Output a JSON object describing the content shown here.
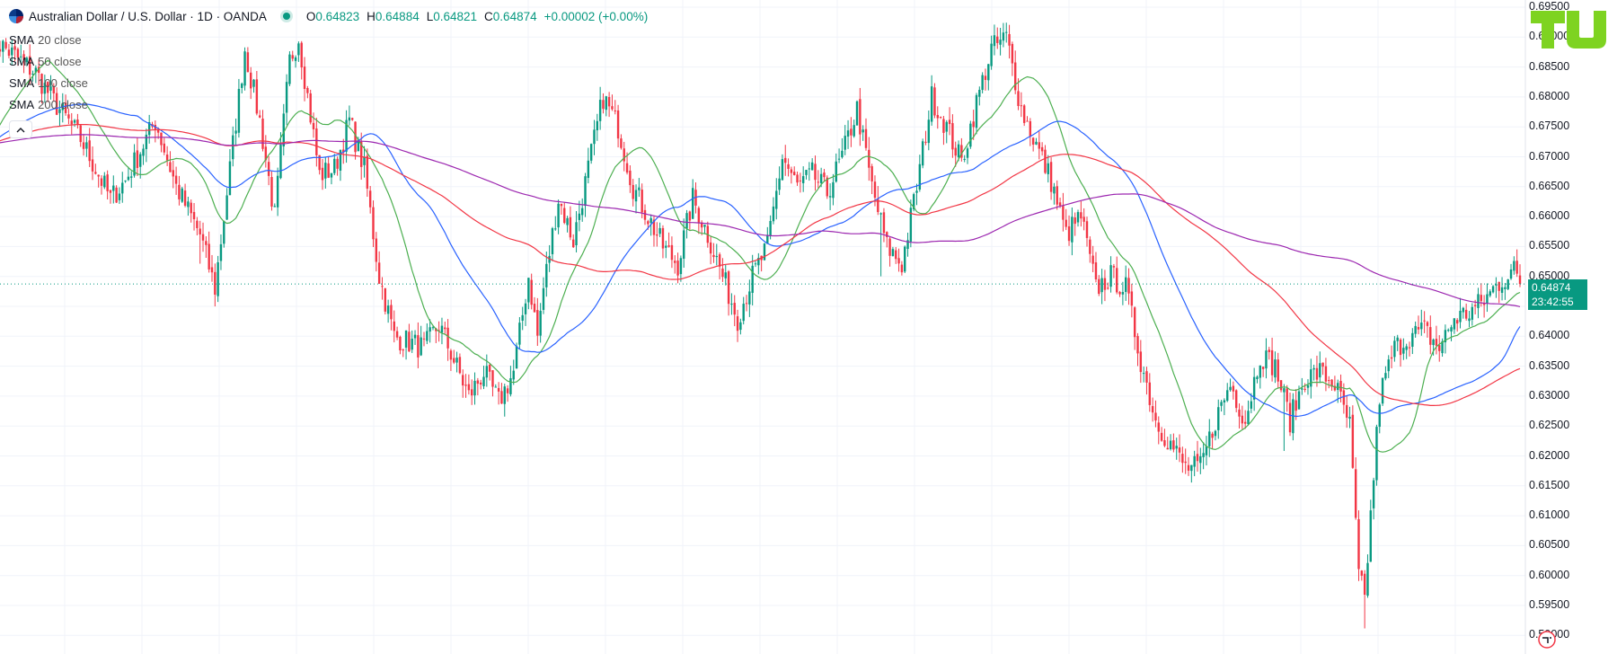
{
  "header": {
    "symbol_title": "Australian Dollar / U.S. Dollar · 1D · OANDA",
    "ohlc": {
      "o_label": "O",
      "o": "0.64823",
      "h_label": "H",
      "h": "0.64884",
      "l_label": "L",
      "l": "0.64821",
      "c_label": "C",
      "c": "0.64874",
      "change": "+0.00002 (+0.00%)"
    }
  },
  "indicators": [
    {
      "name": "SMA",
      "params": "20 close",
      "color": "#4caf50"
    },
    {
      "name": "SMA",
      "params": "50 close",
      "color": "#2962ff"
    },
    {
      "name": "SMA",
      "params": "100 close",
      "color": "#f23645"
    },
    {
      "name": "SMA",
      "params": "200 close",
      "color": "#9c27b0"
    }
  ],
  "collapse_icon": "chevron-up-icon",
  "price_scale": {
    "labels": [
      "0.69500",
      "0.69000",
      "0.68500",
      "0.68000",
      "0.67500",
      "0.67000",
      "0.66500",
      "0.66000",
      "0.65500",
      "0.65000",
      "0.64500",
      "0.64000",
      "0.63500",
      "0.63000",
      "0.62500",
      "0.62000",
      "0.61500",
      "0.61000",
      "0.60500",
      "0.60000",
      "0.59500",
      "0.59000"
    ],
    "last_price": "0.64874",
    "countdown": "23:42:55"
  },
  "colors": {
    "up": "#089981",
    "down": "#f23645",
    "grid": "#f0f3fa",
    "last_price_line": "#089981"
  },
  "logo_icon": "tradingview-logo-icon",
  "chart_data": {
    "type": "candlestick",
    "interval": "1D",
    "ylim": [
      0.5882,
      0.6955
    ],
    "keypoints": [
      [
        0,
        0.69
      ],
      [
        10,
        0.686
      ],
      [
        15,
        0.684
      ],
      [
        20,
        0.68
      ],
      [
        30,
        0.673
      ],
      [
        40,
        0.663
      ],
      [
        45,
        0.666
      ],
      [
        55,
        0.676
      ],
      [
        62,
        0.665
      ],
      [
        70,
        0.657
      ],
      [
        75,
        0.648
      ],
      [
        80,
        0.668
      ],
      [
        85,
        0.688
      ],
      [
        90,
        0.676
      ],
      [
        95,
        0.66
      ],
      [
        100,
        0.686
      ],
      [
        103,
        0.69
      ],
      [
        110,
        0.667
      ],
      [
        115,
        0.668
      ],
      [
        120,
        0.676
      ],
      [
        125,
        0.668
      ],
      [
        130,
        0.65
      ],
      [
        135,
        0.64
      ],
      [
        145,
        0.638
      ],
      [
        150,
        0.642
      ],
      [
        155,
        0.636
      ],
      [
        160,
        0.63
      ],
      [
        165,
        0.634
      ],
      [
        170,
        0.629
      ],
      [
        175,
        0.634
      ],
      [
        180,
        0.65
      ],
      [
        183,
        0.64
      ],
      [
        185,
        0.648
      ],
      [
        190,
        0.663
      ],
      [
        195,
        0.656
      ],
      [
        205,
        0.68
      ],
      [
        210,
        0.675
      ],
      [
        215,
        0.665
      ],
      [
        220,
        0.66
      ],
      [
        225,
        0.655
      ],
      [
        230,
        0.652
      ],
      [
        235,
        0.663
      ],
      [
        240,
        0.657
      ],
      [
        245,
        0.65
      ],
      [
        250,
        0.643
      ],
      [
        255,
        0.65
      ],
      [
        260,
        0.655
      ],
      [
        265,
        0.67
      ],
      [
        270,
        0.665
      ],
      [
        275,
        0.667
      ],
      [
        280,
        0.664
      ],
      [
        285,
        0.67
      ],
      [
        290,
        0.678
      ],
      [
        295,
        0.665
      ],
      [
        300,
        0.655
      ],
      [
        305,
        0.652
      ],
      [
        310,
        0.665
      ],
      [
        315,
        0.68
      ],
      [
        320,
        0.675
      ],
      [
        325,
        0.669
      ],
      [
        330,
        0.679
      ],
      [
        335,
        0.688
      ],
      [
        340,
        0.69
      ],
      [
        345,
        0.678
      ],
      [
        350,
        0.672
      ],
      [
        355,
        0.666
      ],
      [
        360,
        0.657
      ],
      [
        365,
        0.66
      ],
      [
        370,
        0.648
      ],
      [
        375,
        0.65
      ],
      [
        380,
        0.648
      ],
      [
        385,
        0.636
      ],
      [
        390,
        0.626
      ],
      [
        395,
        0.622
      ],
      [
        400,
        0.618
      ],
      [
        405,
        0.618
      ],
      [
        410,
        0.626
      ],
      [
        415,
        0.632
      ],
      [
        420,
        0.626
      ],
      [
        425,
        0.637
      ],
      [
        430,
        0.635
      ],
      [
        435,
        0.626
      ],
      [
        440,
        0.633
      ],
      [
        445,
        0.634
      ],
      [
        450,
        0.632
      ],
      [
        455,
        0.625
      ],
      [
        458,
        0.6
      ],
      [
        460,
        0.596
      ],
      [
        462,
        0.61
      ],
      [
        465,
        0.63
      ],
      [
        470,
        0.638
      ],
      [
        475,
        0.64
      ],
      [
        480,
        0.641
      ],
      [
        485,
        0.638
      ],
      [
        490,
        0.643
      ],
      [
        495,
        0.644
      ],
      [
        500,
        0.646
      ],
      [
        505,
        0.649
      ],
      [
        510,
        0.651
      ],
      [
        512,
        0.6487
      ]
    ],
    "moving_averages": [
      {
        "name": "SMA 20 close",
        "period": 20,
        "color": "#4caf50"
      },
      {
        "name": "SMA 50 close",
        "period": 50,
        "color": "#2962ff"
      },
      {
        "name": "SMA 100 close",
        "period": 100,
        "color": "#f23645"
      },
      {
        "name": "SMA 200 close",
        "period": 200,
        "color": "#9c27b0"
      }
    ],
    "last_close": 0.64874
  }
}
